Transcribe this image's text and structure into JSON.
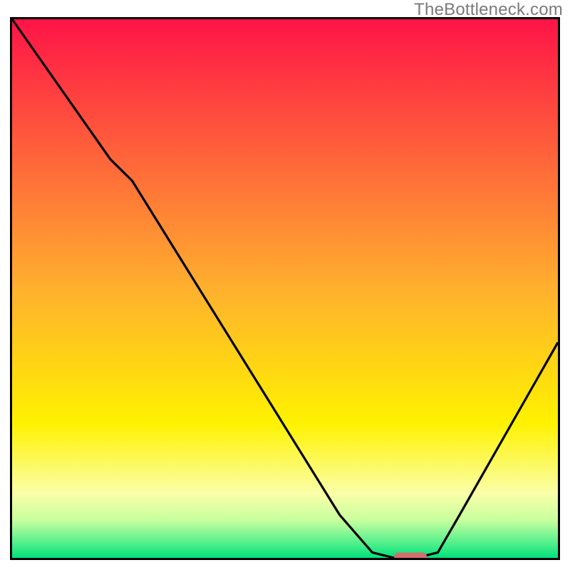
{
  "watermark": "TheBottleneck.com",
  "chart_data": {
    "type": "line",
    "title": "",
    "xlabel": "",
    "ylabel": "",
    "xlim": [
      0,
      100
    ],
    "ylim": [
      0,
      100
    ],
    "grid": false,
    "series": [
      {
        "name": "bottleneck-curve",
        "x": [
          0,
          18,
          22,
          60,
          66,
          70,
          74,
          78,
          82,
          100
        ],
        "values": [
          100,
          74,
          70,
          8,
          1,
          0,
          0,
          1,
          8,
          40
        ]
      }
    ],
    "marker": {
      "name": "optimal-range-marker",
      "x_start": 70,
      "x_end": 76,
      "y": 0,
      "color": "#d66b6b"
    },
    "background_gradient": {
      "type": "vertical",
      "stops": [
        {
          "pos": 0.0,
          "color": "#ff1447"
        },
        {
          "pos": 0.5,
          "color": "#ffb02e"
        },
        {
          "pos": 0.75,
          "color": "#fff200"
        },
        {
          "pos": 0.88,
          "color": "#faffa8"
        },
        {
          "pos": 0.93,
          "color": "#c8ff9e"
        },
        {
          "pos": 0.97,
          "color": "#5af08e"
        },
        {
          "pos": 1.0,
          "color": "#00e27a"
        }
      ]
    }
  }
}
